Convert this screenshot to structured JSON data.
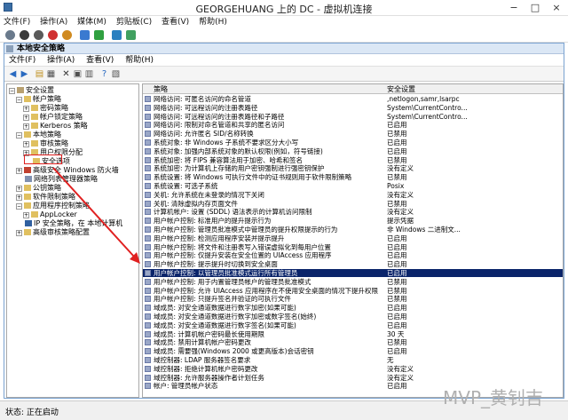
{
  "vm": {
    "title": "GEORGEHUANG 上的 DC - 虚拟机连接",
    "menu": [
      "文件(F)",
      "操作(A)",
      "媒体(M)",
      "剪贴板(C)",
      "查看(V)",
      "帮助(H)"
    ]
  },
  "mmc": {
    "title": "本地安全策略",
    "menu": [
      "文件(F)",
      "操作(A)",
      "查看(V)",
      "帮助(H)"
    ]
  },
  "tree": {
    "items": [
      {
        "label": "安全设置",
        "level": 0,
        "exp": "-"
      },
      {
        "label": "帐户策略",
        "level": 1,
        "exp": "-"
      },
      {
        "label": "密码策略",
        "level": 2,
        "exp": "+"
      },
      {
        "label": "帐户锁定策略",
        "level": 2,
        "exp": "+"
      },
      {
        "label": "Kerberos 策略",
        "level": 2,
        "exp": "+"
      },
      {
        "label": "本地策略",
        "level": 1,
        "exp": "-"
      },
      {
        "label": "审核策略",
        "level": 2,
        "exp": "+"
      },
      {
        "label": "用户权限分配",
        "level": 2,
        "exp": "+"
      },
      {
        "label": "安全选项",
        "level": 2,
        "exp": ""
      },
      {
        "label": "高级安全 Windows 防火墙",
        "level": 1,
        "exp": "+"
      },
      {
        "label": "网络列表管理器策略",
        "level": 1,
        "exp": ""
      },
      {
        "label": "公钥策略",
        "level": 1,
        "exp": "+"
      },
      {
        "label": "软件限制策略",
        "level": 1,
        "exp": "+"
      },
      {
        "label": "应用程序控制策略",
        "level": 1,
        "exp": "-"
      },
      {
        "label": "AppLocker",
        "level": 2,
        "exp": "+"
      },
      {
        "label": "IP 安全策略，在 本地计算机",
        "level": 1,
        "exp": "+"
      },
      {
        "label": "高级审核策略配置",
        "level": 1,
        "exp": "+"
      }
    ]
  },
  "list": {
    "headers": {
      "policy": "策略",
      "setting": "安全设置"
    },
    "rows": [
      {
        "policy": "网络访问: 可匿名访问的命名管道",
        "setting": ",netlogon,samr,lsarpc"
      },
      {
        "policy": "网络访问: 可远程访问的注册表路径",
        "setting": "System\\CurrentContro..."
      },
      {
        "policy": "网络访问: 可远程访问的注册表路径和子路径",
        "setting": "System\\CurrentContro..."
      },
      {
        "policy": "网络访问: 限制对命名管道和共享的匿名访问",
        "setting": "已启用"
      },
      {
        "policy": "网络访问: 允许匿名 SID/名称转换",
        "setting": "已禁用"
      },
      {
        "policy": "系统对象: 非 Windows 子系统不要求区分大小写",
        "setting": "已启用"
      },
      {
        "policy": "系统对象: 加强内部系统对象的默认权限(例如，符号链接)",
        "setting": "已启用"
      },
      {
        "policy": "系统加密: 将 FIPS 兼容算法用于加密、哈希和签名",
        "setting": "已禁用"
      },
      {
        "policy": "系统加密: 为计算机上存储的用户密钥强制进行强密钥保护",
        "setting": "没有定义"
      },
      {
        "policy": "系统设置: 将 Windows 可执行文件中的证书规则用于软件限制策略",
        "setting": "已禁用"
      },
      {
        "policy": "系统设置: 可选子系统",
        "setting": "Posix"
      },
      {
        "policy": "关机: 允许系统在未登录的情况下关闭",
        "setting": "没有定义"
      },
      {
        "policy": "关机: 清除虚拟内存页面文件",
        "setting": "已禁用"
      },
      {
        "policy": "计算机帐户: 设置 (SDDL) 语法表示的计算机访问限制",
        "setting": "没有定义"
      },
      {
        "policy": "用户帐户控制: 标准用户的提升提示行为",
        "setting": "提示凭据"
      },
      {
        "policy": "用户帐户控制: 管理员批准模式中管理员的提升权限提示的行为",
        "setting": "非 Windows 二进制文..."
      },
      {
        "policy": "用户帐户控制: 检测应用程序安装并提示提升",
        "setting": "已启用"
      },
      {
        "policy": "用户帐户控制: 将文件和注册表写入错误虚拟化到每用户位置",
        "setting": "已启用"
      },
      {
        "policy": "用户帐户控制: 仅提升安装在安全位置的 UIAccess 应用程序",
        "setting": "已启用"
      },
      {
        "policy": "用户帐户控制: 提示提升时切换到安全桌面",
        "setting": "已启用"
      },
      {
        "policy": "用户帐户控制: 以管理员批准模式运行所有管理员",
        "setting": "已启用",
        "selected": true
      },
      {
        "policy": "用户帐户控制: 用于内置管理员帐户的管理员批准模式",
        "setting": "已禁用"
      },
      {
        "policy": "用户帐户控制: 允许 UIAccess 应用程序在不使用安全桌面的情况下提升权限",
        "setting": "已禁用"
      },
      {
        "policy": "用户帐户控制: 只提升签名并验证的可执行文件",
        "setting": "已禁用"
      },
      {
        "policy": "域成员: 对安全通道数据进行数字加密(如果可能)",
        "setting": "已启用"
      },
      {
        "policy": "域成员: 对安全通道数据进行数字加密或数字签名(始终)",
        "setting": "已启用"
      },
      {
        "policy": "域成员: 对安全通道数据进行数字签名(如果可能)",
        "setting": "已启用"
      },
      {
        "policy": "域成员: 计算机帐户密码最长使用期限",
        "setting": "30 天"
      },
      {
        "policy": "域成员: 禁用计算机帐户密码更改",
        "setting": "已禁用"
      },
      {
        "policy": "域成员: 需要强(Windows 2000 或更高版本)会话密钥",
        "setting": "已启用"
      },
      {
        "policy": "域控制器: LDAP 服务器签名要求",
        "setting": "无"
      },
      {
        "policy": "域控制器: 拒绝计算机帐户密码更改",
        "setting": "没有定义"
      },
      {
        "policy": "域控制器: 允许服务器操作者计划任务",
        "setting": "没有定义"
      },
      {
        "policy": "帐户: 管理员帐户状态",
        "setting": "已启用"
      }
    ]
  },
  "status": {
    "text": "状态: 正在启动"
  },
  "watermark": "MVP_黄钊吉",
  "colors": {
    "selection": "#0a246a",
    "highlight_box": "#e02020",
    "arrow": "#e02020"
  }
}
